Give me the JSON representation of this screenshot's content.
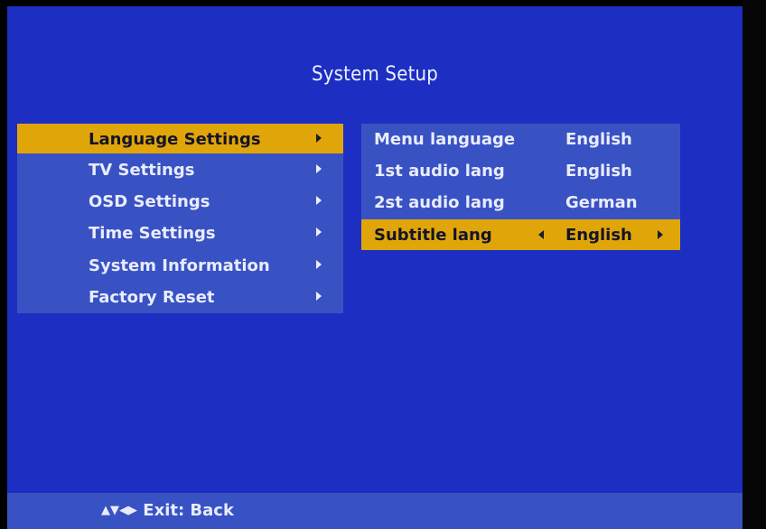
{
  "title": "System Setup",
  "left_menu": {
    "items": [
      {
        "label": "Language Settings",
        "selected": true
      },
      {
        "label": "TV Settings",
        "selected": false
      },
      {
        "label": "OSD Settings",
        "selected": false
      },
      {
        "label": "Time Settings",
        "selected": false
      },
      {
        "label": "System Information",
        "selected": false
      },
      {
        "label": "Factory Reset",
        "selected": false
      }
    ]
  },
  "right_menu": {
    "items": [
      {
        "label": "Menu language",
        "value": "English",
        "selected": false
      },
      {
        "label": "1st audio lang",
        "value": "English",
        "selected": false
      },
      {
        "label": "2st audio lang",
        "value": "German",
        "selected": false
      },
      {
        "label": "Subtitle lang",
        "value": "English",
        "selected": true
      }
    ]
  },
  "footer": {
    "nav_glyphs": "▲▼◀▶",
    "hint": "Exit: Back"
  },
  "colors": {
    "background": "#1d2ec2",
    "panel": "#3852c4",
    "highlight": "#e0a609",
    "text": "#e9ecfb"
  }
}
